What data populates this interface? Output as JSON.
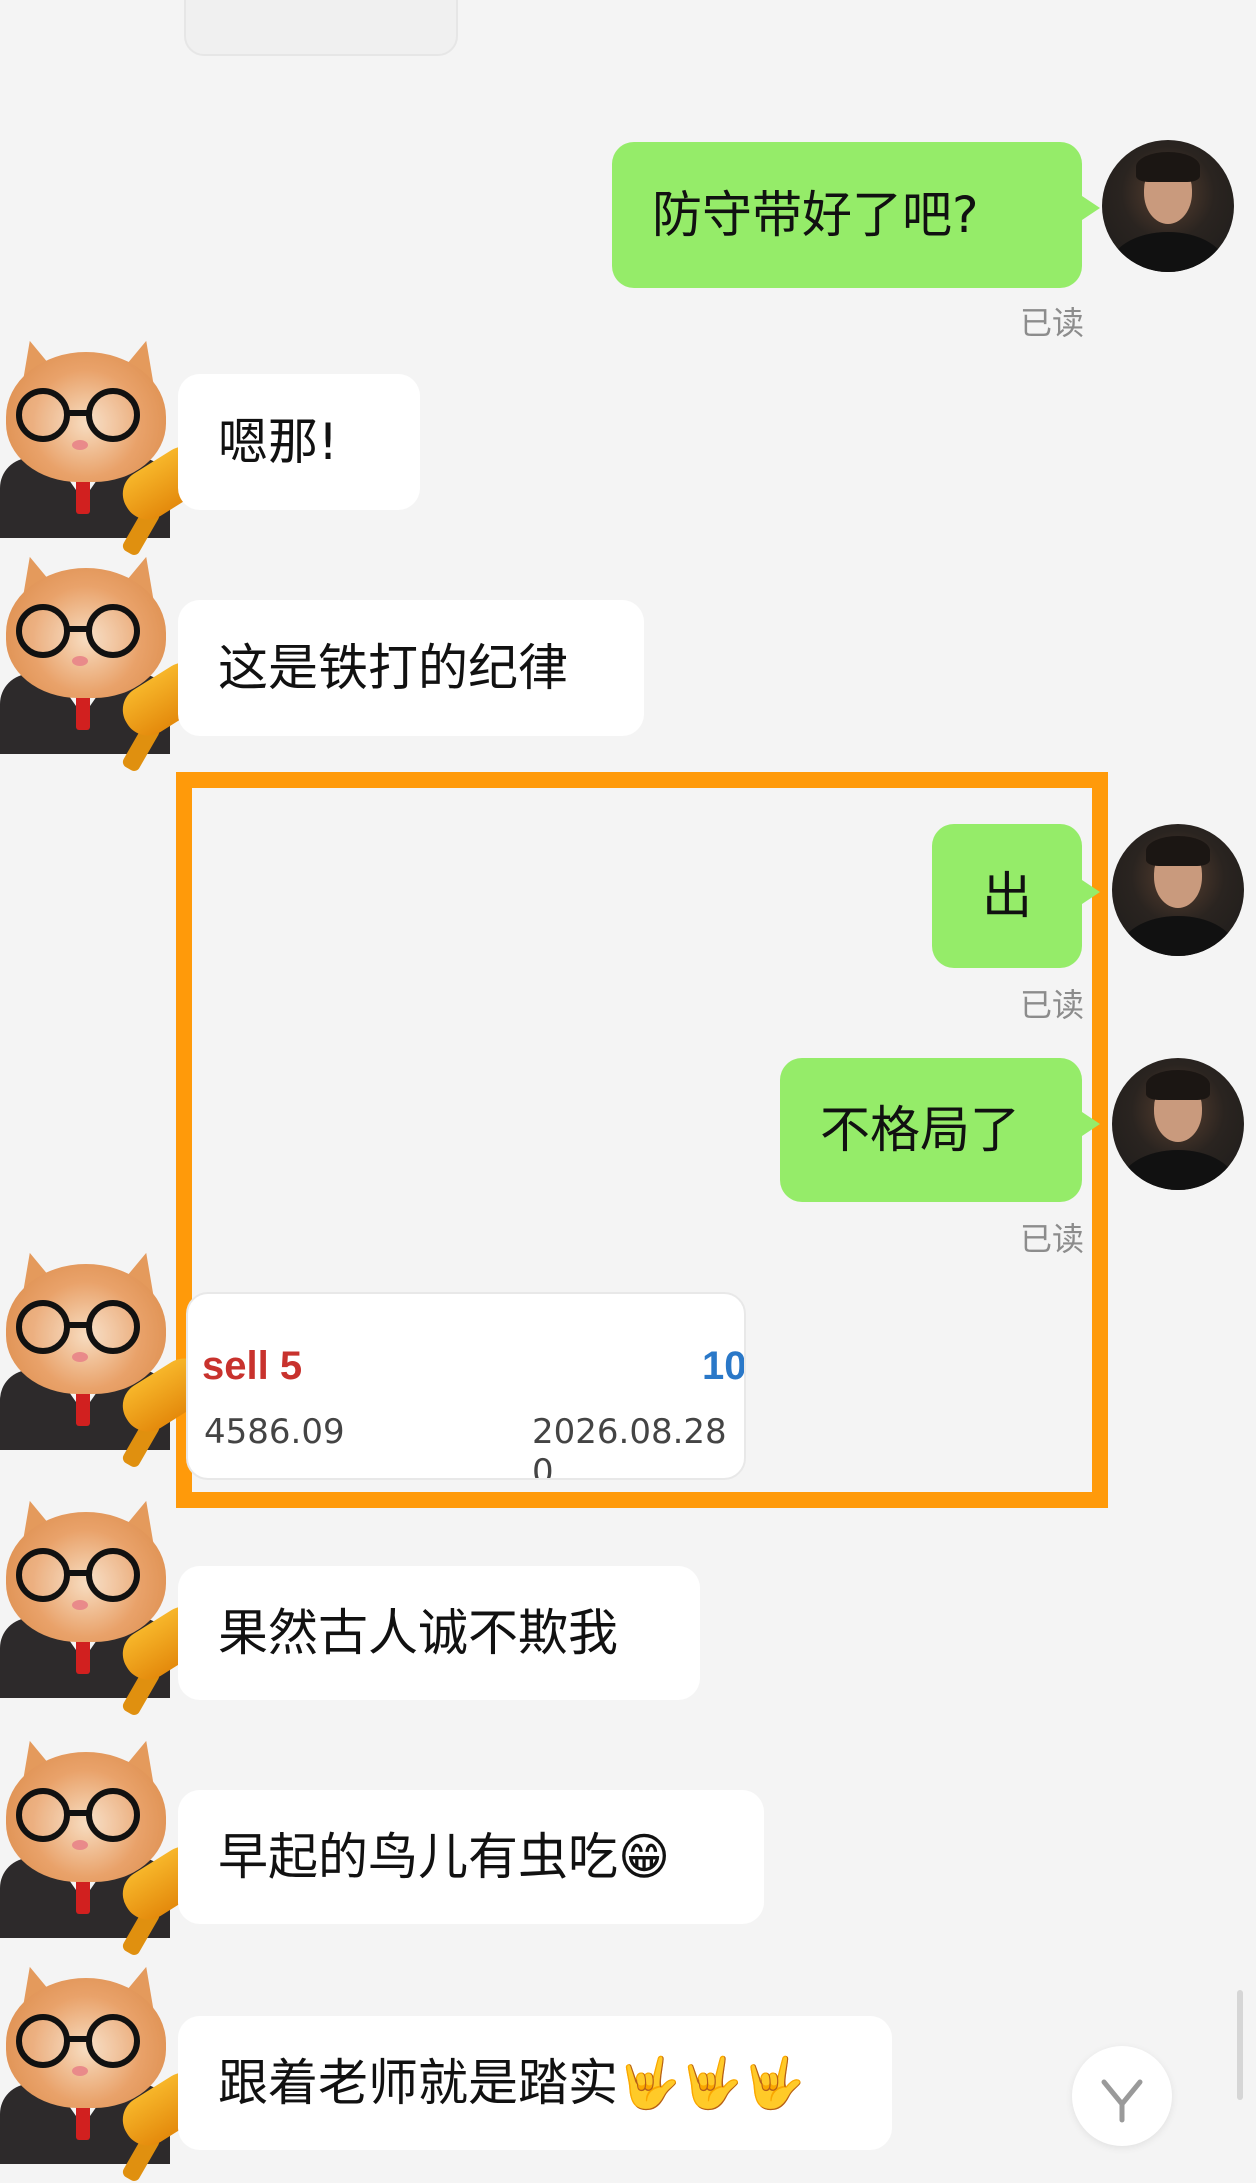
{
  "messages": [
    {
      "text": "防守带好了吧?",
      "read": "已读"
    },
    {
      "text": "嗯那!"
    },
    {
      "text": "这是铁打的纪律"
    },
    {
      "text": "出",
      "read": "已读"
    },
    {
      "text": "不格局了",
      "read": "已读"
    },
    {
      "text": "果然古人诚不欺我"
    },
    {
      "text": "早起的鸟儿有虫吃😁"
    },
    {
      "text": "跟着老师就是踏实🤟🤟🤟"
    }
  ],
  "trade_card": {
    "action": "sell 5",
    "number": "10",
    "price": "4586.09",
    "date": "2026.08.28 0"
  },
  "highlight_color": "#ff9a0a",
  "bubble_out_color": "#95ec69",
  "scroll_icon": "chevron-down-icon"
}
